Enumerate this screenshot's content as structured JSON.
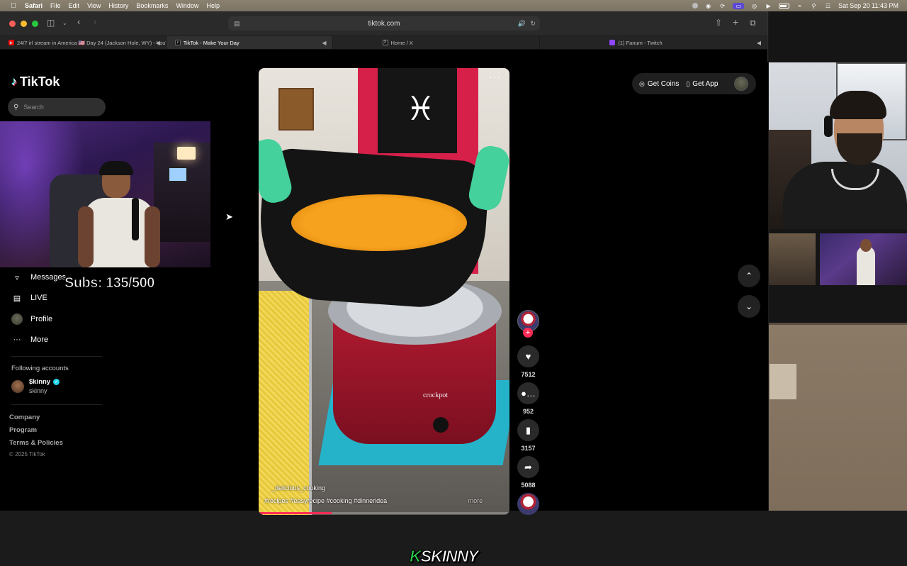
{
  "menubar": {
    "app": "Safari",
    "items": [
      "File",
      "Edit",
      "View",
      "History",
      "Bookmarks",
      "Window",
      "Help"
    ],
    "clock": "Sat Sep 20  11:43 PM"
  },
  "browser": {
    "url": "tiktok.com",
    "tabs": [
      {
        "label": "24/7 irl stream in America 🇺🇸 Day 24 (Jackson Hole, WY) - YouT...",
        "favicon_color": "#ff0000",
        "audio": true,
        "active": false
      },
      {
        "label": "TikTok - Make Your Day",
        "favicon_color": "#000000",
        "audio": true,
        "active": true
      },
      {
        "label": "Home / X",
        "favicon_color": "#000000",
        "audio": false,
        "active": false
      },
      {
        "label": "(1) Fanum - Twitch",
        "favicon_color": "#9146ff",
        "audio": true,
        "active": false
      }
    ]
  },
  "tiktok": {
    "logo": "TikTok",
    "search_placeholder": "Search",
    "nav": [
      {
        "label": "Messages",
        "icon": "send-icon"
      },
      {
        "label": "LIVE",
        "icon": "live-icon"
      },
      {
        "label": "Profile",
        "icon": "avatar"
      },
      {
        "label": "More",
        "icon": "more-icon"
      }
    ],
    "following_header": "Following accounts",
    "following": [
      {
        "name": "$kinny",
        "handle": "skinny",
        "verified": true
      }
    ],
    "footer_links": [
      "Company",
      "Program",
      "Terms & Policies"
    ],
    "copyright": "© 2025 TikTok",
    "top_buttons": {
      "coins": "Get Coins",
      "app": "Get App"
    },
    "video": {
      "author": "_delicious_cooking",
      "hashtags": "#recipes #easyrecipe #cooking #dinneridea",
      "more": "more",
      "appliance_brand": "crockpot",
      "progress": 0.29
    },
    "actions": [
      {
        "icon": "heart-icon",
        "count": "7512"
      },
      {
        "icon": "comment-icon",
        "count": "952"
      },
      {
        "icon": "bookmark-icon",
        "count": "3157"
      },
      {
        "icon": "share-icon",
        "count": "5088"
      }
    ]
  },
  "overlay": {
    "subs_counter": "Subs: 135/500",
    "watermark_k": "K",
    "watermark_rest": "SKINNY"
  }
}
